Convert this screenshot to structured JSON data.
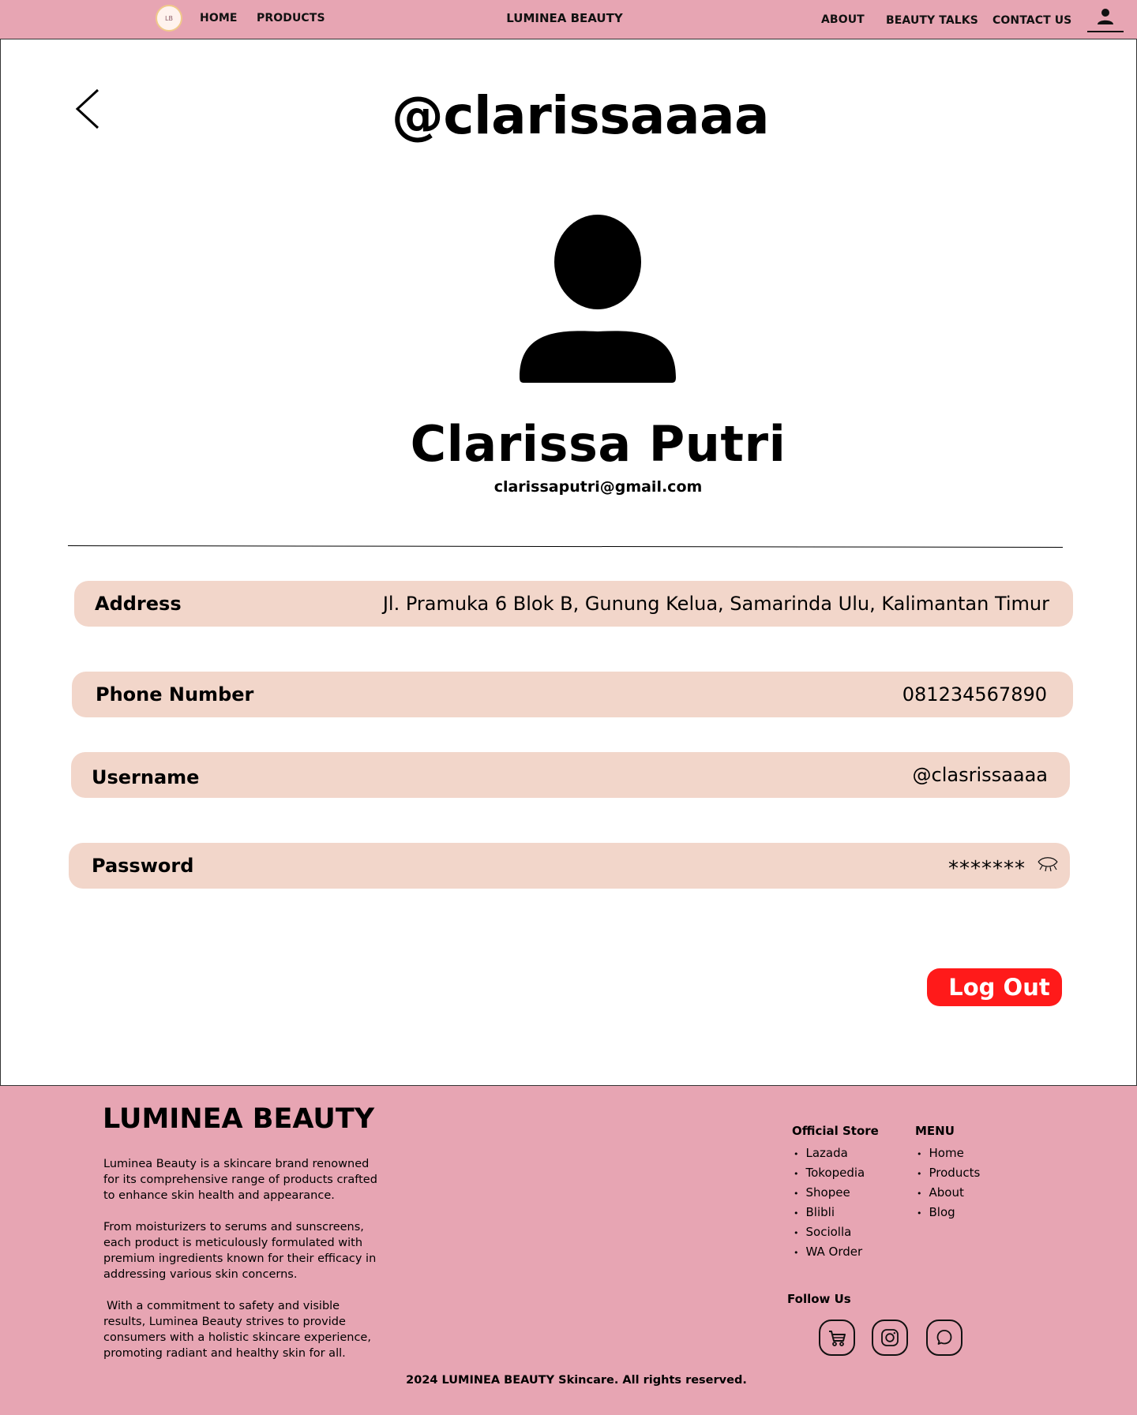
{
  "nav": {
    "logo_text": "LB",
    "home": "HOME",
    "products": "PRODUCTS",
    "title": "LUMINEA BEAUTY",
    "about": "ABOUT",
    "beauty_talks": "BEAUTY TALKS",
    "contact": "CONTACT US"
  },
  "profile": {
    "handle": "@clarissaaaa",
    "full_name": "Clarissa Putri",
    "email": "clarissaputri@gmail.com"
  },
  "fields": {
    "address": {
      "label": "Address",
      "value": "Jl. Pramuka 6 Blok B, Gunung Kelua, Samarinda Ulu, Kalimantan Timur"
    },
    "phone": {
      "label": "Phone Number",
      "value": "081234567890"
    },
    "username": {
      "label": "Username",
      "value": "@clasrissaaaa"
    },
    "password": {
      "label": "Password",
      "value": "*******"
    }
  },
  "logout_label": "Log Out",
  "footer": {
    "brand": "LUMINEA BEAUTY",
    "about": [
      "Luminea Beauty is a skincare brand renowned for its comprehensive range of products crafted to enhance skin health and appearance.",
      "From moisturizers to serums and sunscreens, each product is meticulously formulated with premium ingredients known for their efficacy in addressing various skin concerns.",
      "With a commitment to safety and visible results, Luminea Beauty strives to provide consumers with a holistic skincare experience, promoting radiant and healthy skin for all."
    ],
    "store_title": "Official Store",
    "stores": [
      "Lazada",
      "Tokopedia",
      "Shopee",
      "Blibli",
      "Sociolla",
      "WA Order"
    ],
    "menu_title": "MENU",
    "menu": [
      "Home",
      "Products",
      "About",
      "Blog"
    ],
    "follow_title": "Follow Us",
    "copyright": "2024 LUMINEA BEAUTY Skincare. All rights reserved."
  },
  "icons": {
    "back": "chevron-left-icon",
    "account": "user-icon",
    "avatar": "user-silhouette-icon",
    "eye": "eye-closed-icon",
    "socials": [
      "shopping-cart-icon",
      "instagram-icon",
      "whatsapp-icon"
    ]
  },
  "colors": {
    "brand_pink": "#e7a5b3",
    "field_bg": "#f2d6ca",
    "logout_red": "#ff1a1a"
  }
}
